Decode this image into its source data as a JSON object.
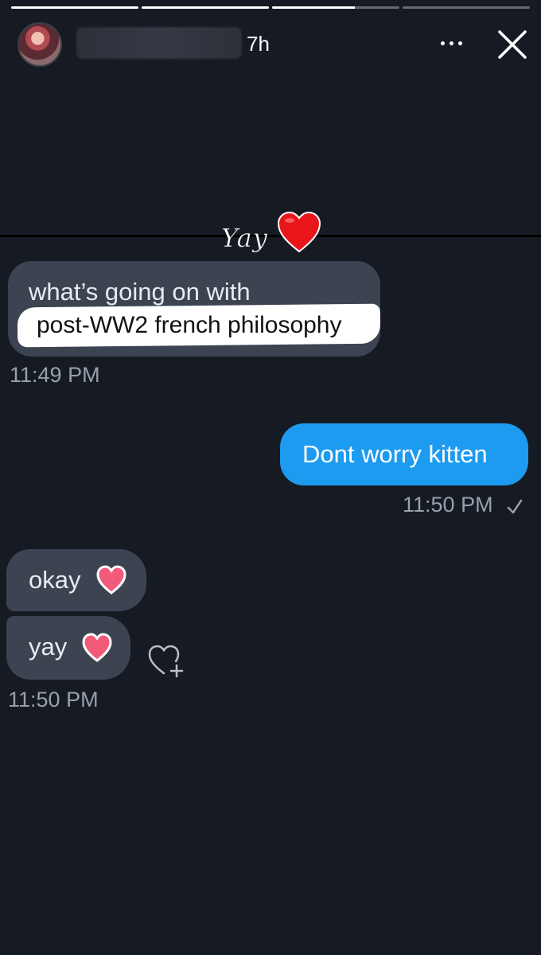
{
  "story": {
    "time_ago": "7h",
    "progress_fill": [
      1.0,
      1.0,
      0.65,
      0.0
    ],
    "avatar_icon": "avatar-photo",
    "more_icon": "more-dots-icon",
    "close_icon": "close-icon"
  },
  "sticker": {
    "text": "Yay",
    "emoji": "red-heart"
  },
  "conversation": {
    "messages": [
      {
        "sender": "them",
        "text": "what’s going on with",
        "highlighted_text": "post-WW2 french philosophy",
        "time": "11:49 PM"
      },
      {
        "sender": "me",
        "text": "Dont worry kitten",
        "time": "11:50 PM",
        "status": "sent-check"
      },
      {
        "sender": "them",
        "text": "okay",
        "emoji": "pink-heart"
      },
      {
        "sender": "them",
        "text": "yay",
        "emoji": "pink-heart",
        "time": "11:50 PM"
      }
    ]
  },
  "colors": {
    "background": "#161b23",
    "incoming_bubble": "#3c4452",
    "outgoing_bubble": "#1d9bf0",
    "timestamp": "#98a0ab"
  }
}
